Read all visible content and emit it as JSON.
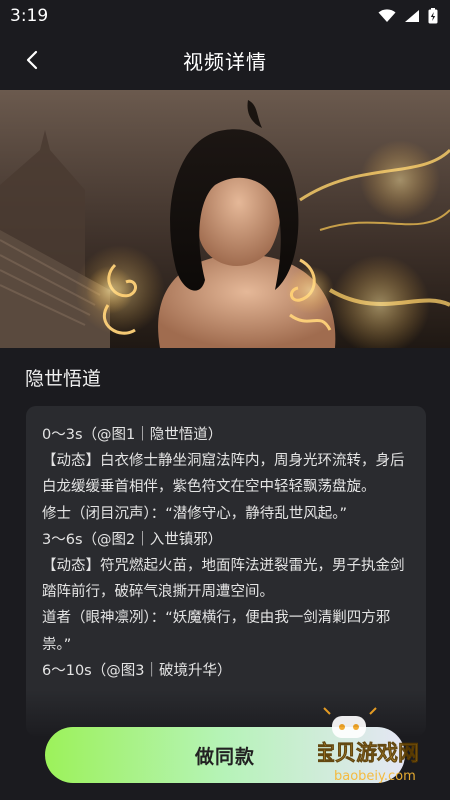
{
  "status_bar": {
    "time": "3:19"
  },
  "header": {
    "title": "视频详情"
  },
  "video": {
    "title": "隐世悟道"
  },
  "prompt": {
    "lines": [
      "0～3s（@图1｜隐世悟道）",
      "【动态】白衣修士静坐洞窟法阵内，周身光环流转，身后白龙缓缓垂首相伴，紫色符文在空中轻轻飘荡盘旋。",
      "修士（闭目沉声）：“潜修守心，静待乱世风起。”",
      "3～6s（@图2｜入世镇邪）",
      "【动态】符咒燃起火苗，地面阵法迸裂雷光，男子执金剑踏阵前行，破碎气浪撕开周遭空间。",
      "道者（眼神凛冽）：“妖魔横行，便由我一剑清剿四方邪祟。”",
      "6～10s（@图3｜破境升华）"
    ]
  },
  "action": {
    "make_same_label": "做同款"
  },
  "watermark": {
    "text": "宝贝游戏网",
    "url": "baobeiy.com"
  },
  "colors": {
    "background": "#1b1b1f",
    "card": "#2a2b2f",
    "button_start": "#9cf25a",
    "button_end": "#e5e6f5"
  }
}
